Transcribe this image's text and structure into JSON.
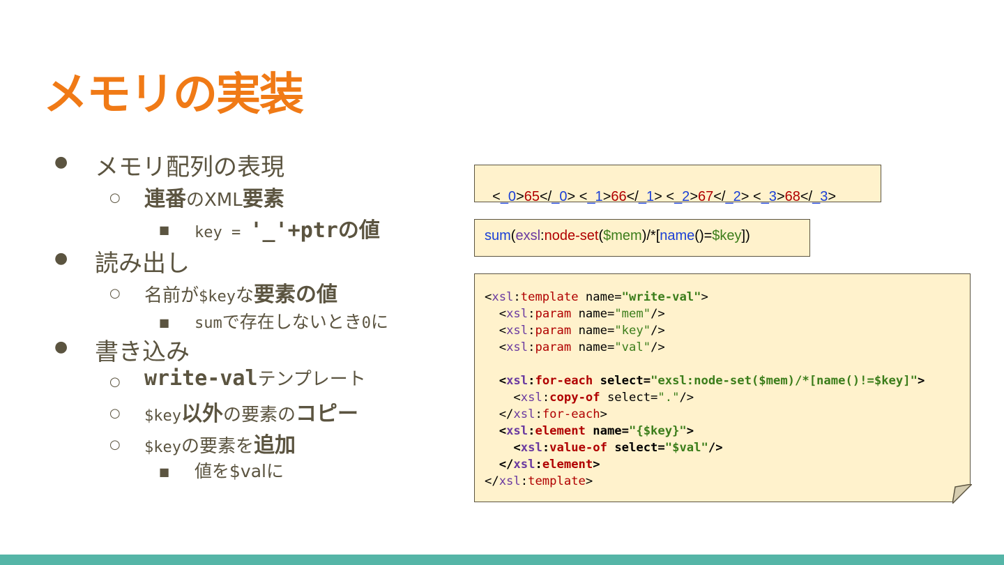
{
  "slide": {
    "title": "メモリの実装",
    "bullets": {
      "b1": "メモリ配列の表現",
      "b1_1_a": "連番",
      "b1_1_b": "のXML",
      "b1_1_c": "要素",
      "b1_1_1_a": "key = ",
      "b1_1_1_b": "'_'+ptr",
      "b1_1_1_c": "の値",
      "b2": "読み出し",
      "b2_1_a": "名前が",
      "b2_1_b": "$key",
      "b2_1_c": "な",
      "b2_1_d": "要素の値",
      "b2_1_1_a": "sum",
      "b2_1_1_b": "で存在しないとき",
      "b2_1_1_c": "0",
      "b2_1_1_d": "に",
      "b3": "書き込み",
      "b3_1_a": "write-val",
      "b3_1_b": "テンプレート",
      "b3_2_a": "$key",
      "b3_2_b": "以外",
      "b3_2_c": "の要素の",
      "b3_2_d": "コピー",
      "b3_3_a": "$key",
      "b3_3_b": "の要素を",
      "b3_3_c": "追加",
      "b3_3_1": "値を$valに"
    },
    "markers": {
      "l1": "●",
      "l2": "○",
      "l3": "■"
    }
  },
  "code": {
    "box1": [
      [
        "<",
        "_0",
        ">",
        "65",
        "</",
        "_0",
        ">"
      ],
      [
        "<",
        "_1",
        ">",
        "66",
        "</",
        "_1",
        ">"
      ],
      [
        "<",
        "_2",
        ">",
        "67",
        "</",
        "_2",
        ">"
      ],
      [
        "<",
        "_3",
        ">",
        "68",
        "</",
        "_3",
        ">"
      ]
    ],
    "box2": {
      "t1": "sum",
      "t2": "(",
      "t3": "exsl",
      "t4": ":",
      "t5": "node-set",
      "t6": "(",
      "t7": "$mem",
      "t8": ")/*[",
      "t9": "name",
      "t10": "()=",
      "t11": "$key",
      "t12": "])"
    },
    "box3": {
      "l1": {
        "a": "<",
        "ns": "xsl",
        "c": ":",
        "tag": "template",
        "attr": " name=",
        "val": "\"write-val\"",
        "end": ">"
      },
      "l2": {
        "ind": "  ",
        "a": "<",
        "ns": "xsl",
        "c": ":",
        "tag": "param",
        "attr": " name=",
        "val": "\"mem\"",
        "end": "/>"
      },
      "l3": {
        "ind": "  ",
        "a": "<",
        "ns": "xsl",
        "c": ":",
        "tag": "param",
        "attr": " name=",
        "val": "\"key\"",
        "end": "/>"
      },
      "l4": {
        "ind": "  ",
        "a": "<",
        "ns": "xsl",
        "c": ":",
        "tag": "param",
        "attr": " name=",
        "val": "\"val\"",
        "end": "/>"
      },
      "l6": {
        "ind": "  ",
        "a": "<",
        "ns": "xsl",
        "c": ":",
        "tag": "for-each",
        "attr": " select=",
        "val": "\"exsl:node-set($mem)/*[name()!=$key]\"",
        "end": ">"
      },
      "l7": {
        "ind": "    ",
        "a": "<",
        "ns": "xsl",
        "c": ":",
        "tag": "copy-of",
        "attr": " select=",
        "val": "\".\"",
        "end": "/>"
      },
      "l8": {
        "ind": "  ",
        "a": "</",
        "ns": "xsl",
        "c": ":",
        "tag": "for-each",
        "end": ">"
      },
      "l9": {
        "ind": "  ",
        "a": "<",
        "ns": "xsl",
        "c": ":",
        "tag": "element",
        "attr": " name=",
        "val": "\"{$key}\"",
        "end": ">"
      },
      "l10": {
        "ind": "    ",
        "a": "<",
        "ns": "xsl",
        "c": ":",
        "tag": "value-of",
        "attr": " select=",
        "val": "\"$val\"",
        "end": "/>"
      },
      "l11": {
        "ind": "  ",
        "a": "</",
        "ns": "xsl",
        "c": ":",
        "tag": "element",
        "end": ">"
      },
      "l12": {
        "a": "</",
        "ns": "xsl",
        "c": ":",
        "tag": "template",
        "end": ">"
      }
    }
  },
  "colors": {
    "title": "#f07a16",
    "text": "#5b5440",
    "code_bg": "#fff2cc",
    "footer": "#55b5a7"
  }
}
